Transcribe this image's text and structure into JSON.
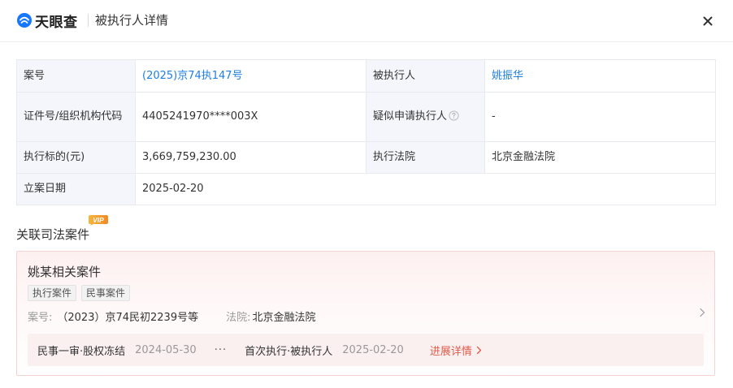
{
  "header": {
    "logo_text": "天眼查",
    "title": "被执行人详情",
    "icons": {
      "logo": "tianyancha-logo-icon",
      "close": "close-icon"
    }
  },
  "details": {
    "case_no_label": "案号",
    "case_no_value": "(2025)京74执147号",
    "executed_person_label": "被执行人",
    "executed_person_value": "姚振华",
    "id_label": "证件号/组织机构代码",
    "id_value": "4405241970****003X",
    "applicant_label": "疑似申请执行人",
    "applicant_value": "-",
    "amount_label": "执行标的(元)",
    "amount_value": "3,669,759,230.00",
    "court_label": "执行法院",
    "court_value": "北京金融法院",
    "filing_date_label": "立案日期",
    "filing_date_value": "2025-02-20"
  },
  "related": {
    "section_title": "关联司法案件",
    "vip_label": "VIP",
    "card": {
      "title": "姚某相关案件",
      "tags": [
        "执行案件",
        "民事案件"
      ],
      "case_no_label": "案号:",
      "case_no_value": "（2023）京74民初2239号等",
      "court_label": "法院:",
      "court_value": "北京金融法院",
      "timeline": {
        "first_event": "民事一审·股权冻结",
        "first_date": "2024-05-30",
        "ellipsis": "···",
        "second_event": "首次执行·被执行人",
        "second_date": "2025-02-20",
        "progress_link": "进展详情"
      }
    }
  },
  "colors": {
    "link_blue": "#1f7fe0",
    "accent_red": "#e05a4a",
    "label_bg": "#f4f6fb",
    "logo_blue": "#1677ff"
  }
}
